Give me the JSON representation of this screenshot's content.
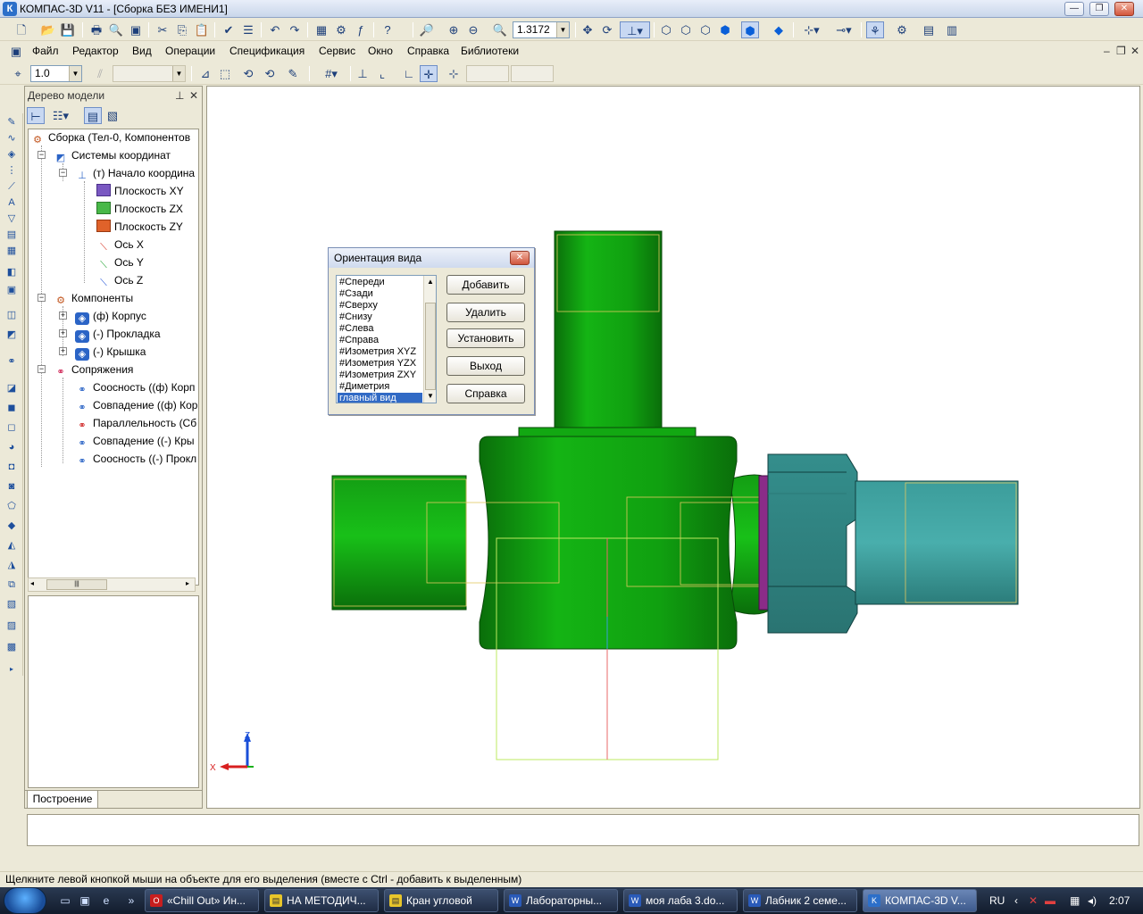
{
  "window": {
    "title": "КОМПАС-3D V11 - [Сборка БЕЗ ИМЕНИ1]",
    "app_icon": "К"
  },
  "toolbar_main": {
    "zoom_value": "1.3172"
  },
  "menu": {
    "items": [
      "Файл",
      "Редактор",
      "Вид",
      "Операции",
      "Спецификация",
      "Сервис",
      "Окно",
      "Справка",
      "Библиотеки"
    ]
  },
  "toolbar_current": {
    "step_value": "1.0"
  },
  "tree_panel": {
    "title": "Дерево модели",
    "nodes": [
      {
        "label": "Сборка (Тел-0, Компонентов",
        "icon": "assembly-icon"
      },
      {
        "label": "Системы координат",
        "icon": "coordinate-systems-icon"
      },
      {
        "label": "(т) Начало координа",
        "icon": "origin-icon"
      },
      {
        "label": "Плоскость XY",
        "icon": "plane-xy-icon"
      },
      {
        "label": "Плоскость ZX",
        "icon": "plane-zx-icon"
      },
      {
        "label": "Плоскость ZY",
        "icon": "plane-zy-icon"
      },
      {
        "label": "Ось X",
        "icon": "axis-x-icon"
      },
      {
        "label": "Ось Y",
        "icon": "axis-y-icon"
      },
      {
        "label": "Ось Z",
        "icon": "axis-z-icon"
      },
      {
        "label": "Компоненты",
        "icon": "components-icon"
      },
      {
        "label": "(ф) Корпус",
        "icon": "part-icon"
      },
      {
        "label": "(-) Прокладка",
        "icon": "part-icon"
      },
      {
        "label": "(-) Крышка",
        "icon": "part-icon"
      },
      {
        "label": "Сопряжения",
        "icon": "mates-icon"
      },
      {
        "label": "Соосность ((ф) Корп",
        "icon": "mate-icon"
      },
      {
        "label": "Совпадение ((ф) Кор",
        "icon": "mate-icon"
      },
      {
        "label": "Параллельность (Сб",
        "icon": "mate-error-icon"
      },
      {
        "label": "Совпадение ((-) Кры",
        "icon": "mate-icon"
      },
      {
        "label": "Соосность ((-) Прокл",
        "icon": "mate-icon"
      }
    ],
    "tab": "Построение"
  },
  "dialog": {
    "title": "Ориентация вида",
    "list": [
      "#Спереди",
      "#Сзади",
      "#Сверху",
      "#Снизу",
      "#Слева",
      "#Справа",
      "#Изометрия XYZ",
      "#Изометрия YZX",
      "#Изометрия ZXY",
      "#Диметрия",
      "главный вид"
    ],
    "selected": "главный вид",
    "buttons": {
      "add": "Добавить",
      "delete": "Удалить",
      "set": "Установить",
      "exit": "Выход",
      "help": "Справка"
    }
  },
  "axes": {
    "z": "Z",
    "x": "X"
  },
  "status": {
    "text": "Щелкните левой кнопкой мыши на объекте для его выделения (вместе с Ctrl - добавить к выделенным)"
  },
  "taskbar": {
    "items": [
      "«Chill Out» Ин...",
      "НА МЕТОДИЧ...",
      "Кран угловой",
      "Лабораторны...",
      "моя лаба 3.do...",
      "Лабник 2 семе...",
      "КОМПАС-3D V..."
    ],
    "lang": "RU",
    "clock": "2:07"
  },
  "colors": {
    "body_green": "#0f9a10",
    "nut_teal": "#3a9a98",
    "gasket_purple": "#8a2c88",
    "selection": "#316ac5"
  }
}
